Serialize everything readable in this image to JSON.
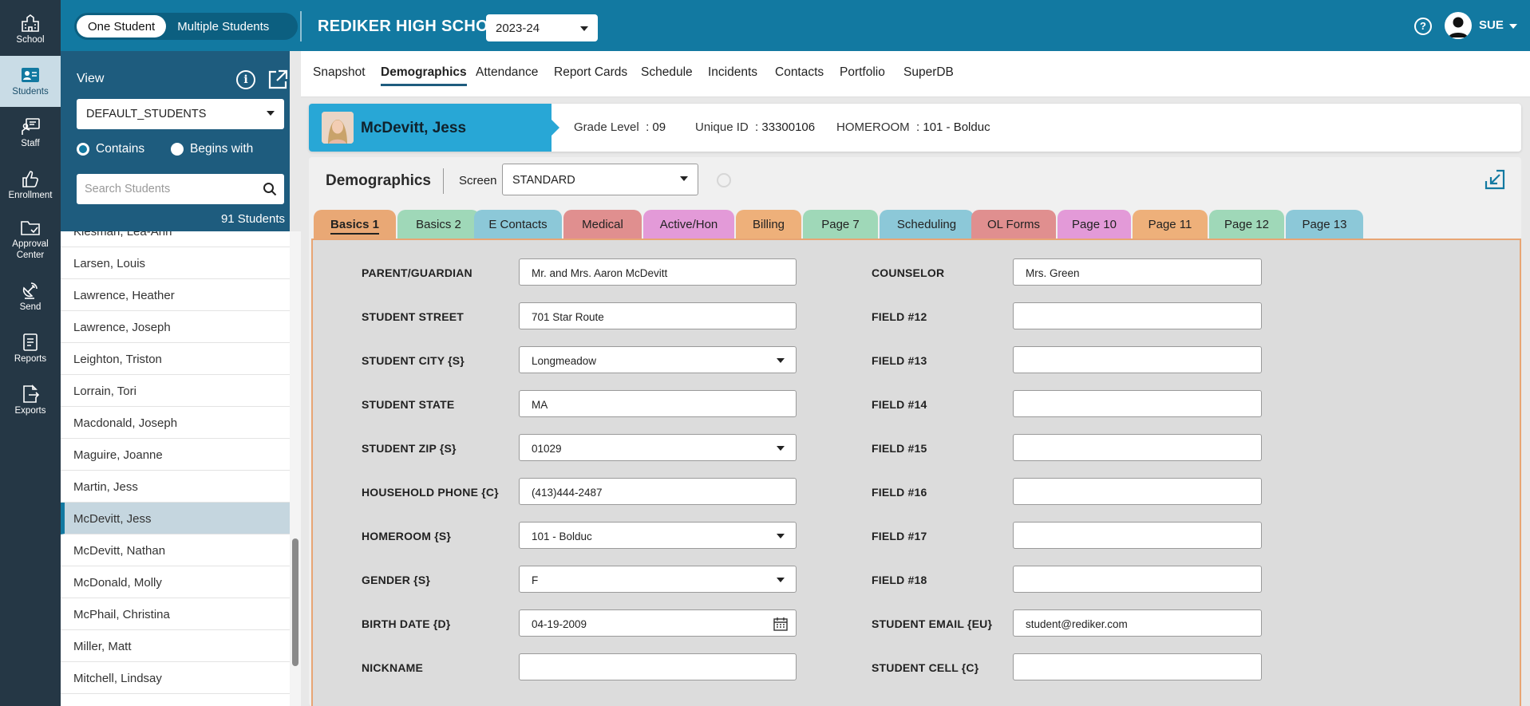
{
  "rail": {
    "items": [
      {
        "label": "School",
        "icon": "school-icon"
      },
      {
        "label": "Students",
        "icon": "students-icon",
        "active": true
      },
      {
        "label": "Staff",
        "icon": "staff-icon"
      },
      {
        "label": "Enrollment",
        "icon": "thumbs-up-icon"
      },
      {
        "label": "Approval Center",
        "icon": "folder-check-icon"
      },
      {
        "label": "Send",
        "icon": "satellite-icon"
      },
      {
        "label": "Reports",
        "icon": "reports-icon"
      },
      {
        "label": "Exports",
        "icon": "export-icon"
      }
    ]
  },
  "topbar": {
    "mode_one": "One Student",
    "mode_multi": "Multiple Students",
    "school_name": "REDIKER HIGH SCHOOL",
    "year": "2023-24",
    "help": "?",
    "user": "SUE",
    "bg_color": "#1279a1"
  },
  "sidebar": {
    "view_label": "View",
    "info": "i",
    "view_value": "DEFAULT_STUDENTS",
    "contains_label": "Contains",
    "begins_label": "Begins with",
    "search_placeholder": "Search Students",
    "count": "91 Students",
    "students": [
      "Kiesman, Lea-Ann",
      "Larsen, Louis",
      "Lawrence, Heather",
      "Lawrence, Joseph",
      "Leighton, Triston",
      "Lorrain, Tori",
      "Macdonald, Joseph",
      "Maguire, Joanne",
      "Martin, Jess",
      "McDevitt, Jess",
      "McDevitt, Nathan",
      "McDonald, Molly",
      "McPhail, Christina",
      "Miller, Matt",
      "Mitchell, Lindsay"
    ],
    "selected_student": "McDevitt, Jess"
  },
  "nav": {
    "tabs": [
      "Snapshot",
      "Demographics",
      "Attendance",
      "Report Cards",
      "Schedule",
      "Incidents",
      "Contacts",
      "Portfolio",
      "SuperDB"
    ],
    "active": "Demographics"
  },
  "student": {
    "name": "McDevitt, Jess",
    "grade_label": "Grade Level",
    "grade_value": ": 09",
    "uid_label": "Unique ID",
    "uid_value": ": 33300106",
    "homeroom_label": "HOMEROOM",
    "homeroom_value": ": 101 - Bolduc"
  },
  "panel": {
    "title": "Demographics",
    "screen_label": "Screen",
    "screen_value": "STANDARD",
    "tabs": [
      {
        "label": "Basics 1",
        "color": "#e9a875",
        "active": true
      },
      {
        "label": "Basics 2",
        "color": "#9fd8b8"
      },
      {
        "label": "E Contacts",
        "color": "#8cc8d8"
      },
      {
        "label": "Medical",
        "color": "#e08f8f"
      },
      {
        "label": "Active/Hon",
        "color": "#e39ad8"
      },
      {
        "label": "Billing",
        "color": "#eeb07a"
      },
      {
        "label": "Page 7",
        "color": "#9fd8b8"
      },
      {
        "label": "Scheduling",
        "color": "#8cc8d8"
      },
      {
        "label": "OL Forms",
        "color": "#e08f8f"
      },
      {
        "label": "Page 10",
        "color": "#e39ad8"
      },
      {
        "label": "Page 11",
        "color": "#eeb07a"
      },
      {
        "label": "Page 12",
        "color": "#9fd8b8"
      },
      {
        "label": "Page 13",
        "color": "#8cc8d8"
      }
    ]
  },
  "form": {
    "left": [
      {
        "label": "PARENT/GUARDIAN",
        "value": "Mr. and Mrs. Aaron McDevitt",
        "kind": "text"
      },
      {
        "label": "STUDENT STREET",
        "value": "701 Star Route",
        "kind": "text"
      },
      {
        "label": "STUDENT CITY {S}",
        "value": "Longmeadow",
        "kind": "select"
      },
      {
        "label": "STUDENT STATE",
        "value": "MA",
        "kind": "text"
      },
      {
        "label": "STUDENT ZIP {S}",
        "value": "01029",
        "kind": "select"
      },
      {
        "label": "HOUSEHOLD PHONE {C}",
        "value": "(413)444-2487",
        "kind": "text"
      },
      {
        "label": "HOMEROOM {S}",
        "value": "101 - Bolduc",
        "kind": "select"
      },
      {
        "label": "GENDER {S}",
        "value": "F",
        "kind": "select"
      },
      {
        "label": "BIRTH DATE {D}",
        "value": "04-19-2009",
        "kind": "date"
      },
      {
        "label": "NICKNAME",
        "value": "",
        "kind": "text"
      }
    ],
    "right": [
      {
        "label": "COUNSELOR",
        "value": "Mrs. Green"
      },
      {
        "label": "FIELD #12",
        "value": ""
      },
      {
        "label": "FIELD #13",
        "value": ""
      },
      {
        "label": "FIELD #14",
        "value": ""
      },
      {
        "label": "FIELD #15",
        "value": ""
      },
      {
        "label": "FIELD #16",
        "value": ""
      },
      {
        "label": "FIELD #17",
        "value": ""
      },
      {
        "label": "FIELD #18",
        "value": ""
      },
      {
        "label": "STUDENT EMAIL {EU}",
        "value": "student@rediker.com"
      },
      {
        "label": "STUDENT CELL {C}",
        "value": ""
      }
    ]
  }
}
